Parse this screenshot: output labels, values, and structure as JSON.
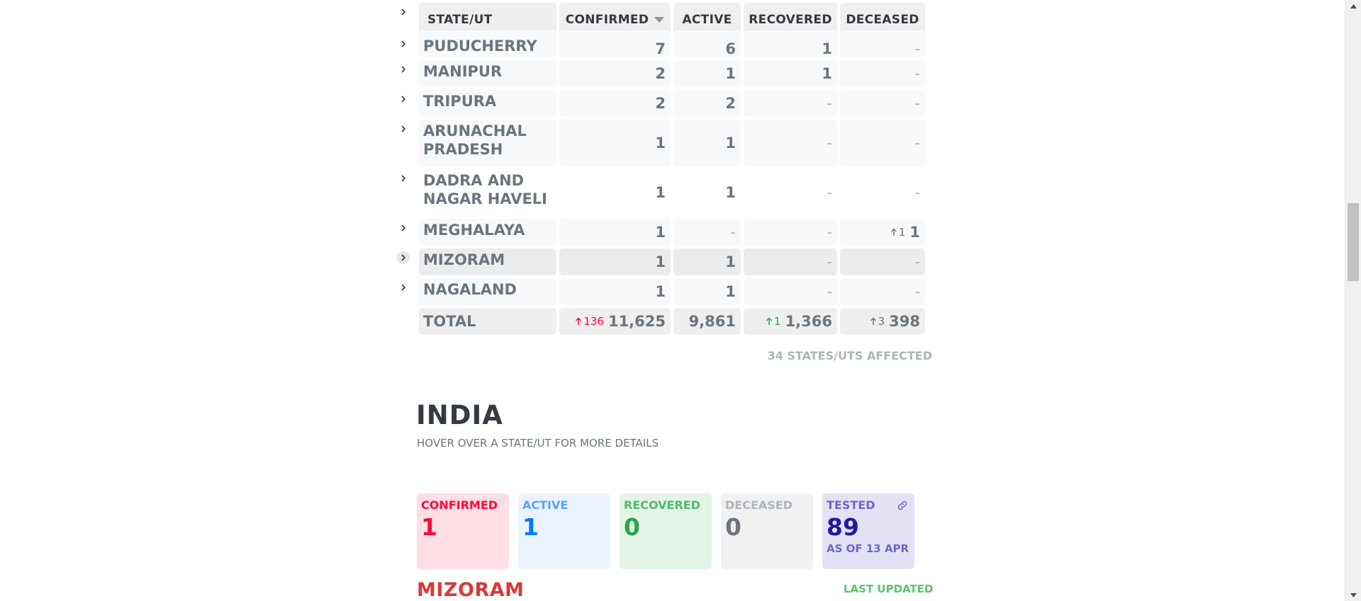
{
  "table": {
    "headers": {
      "state": "STATE/UT",
      "confirmed": "CONFIRMED",
      "active": "ACTIVE",
      "recovered": "RECOVERED",
      "deceased": "DECEASED"
    },
    "rows": [
      {
        "state": "PUDUCHERRY",
        "confirmed": "7",
        "active": "6",
        "recovered": "1",
        "deceased": "-"
      },
      {
        "state": "MANIPUR",
        "confirmed": "2",
        "active": "1",
        "recovered": "1",
        "deceased": "-"
      },
      {
        "state": "TRIPURA",
        "confirmed": "2",
        "active": "2",
        "recovered": "-",
        "deceased": "-"
      },
      {
        "state": "ARUNACHAL PRADESH",
        "confirmed": "1",
        "active": "1",
        "recovered": "-",
        "deceased": "-"
      },
      {
        "state": "DADRA AND NAGAR HAVELI",
        "confirmed": "1",
        "active": "1",
        "recovered": "-",
        "deceased": "-"
      },
      {
        "state": "MEGHALAYA",
        "confirmed": "1",
        "active": "-",
        "recovered": "-",
        "deceased": "1",
        "deceased_delta": "1"
      },
      {
        "state": "MIZORAM",
        "confirmed": "1",
        "active": "1",
        "recovered": "-",
        "deceased": "-"
      },
      {
        "state": "NAGALAND",
        "confirmed": "1",
        "active": "1",
        "recovered": "-",
        "deceased": "-"
      }
    ],
    "total": {
      "label": "TOTAL",
      "confirmed": "11,625",
      "confirmed_delta": "136",
      "active": "9,861",
      "recovered": "1,366",
      "recovered_delta": "1",
      "deceased": "398",
      "deceased_delta": "3"
    },
    "affected": "34 STATES/UTS AFFECTED"
  },
  "map_section": {
    "title": "INDIA",
    "hint": "HOVER OVER A STATE/UT FOR MORE DETAILS",
    "stats": {
      "confirmed": {
        "label": "CONFIRMED",
        "value": "1"
      },
      "active": {
        "label": "ACTIVE",
        "value": "1"
      },
      "recovered": {
        "label": "RECOVERED",
        "value": "0"
      },
      "deceased": {
        "label": "DECEASED",
        "value": "0"
      },
      "tested": {
        "label": "TESTED",
        "value": "89",
        "as_of": "AS OF 13 APR"
      }
    },
    "state_name": "MIZORAM",
    "last_updated_label": "LAST UPDATED"
  },
  "colors": {
    "confirmed": "#ff073a",
    "active": "#007bff",
    "recovered": "#28a745",
    "deceased": "#6c757d",
    "tested": "#201aa2"
  },
  "icons": {
    "expander": "chevron-right-icon",
    "sort": "caret-down-icon",
    "delta": "arrow-up-icon",
    "tested_link": "link-icon"
  }
}
